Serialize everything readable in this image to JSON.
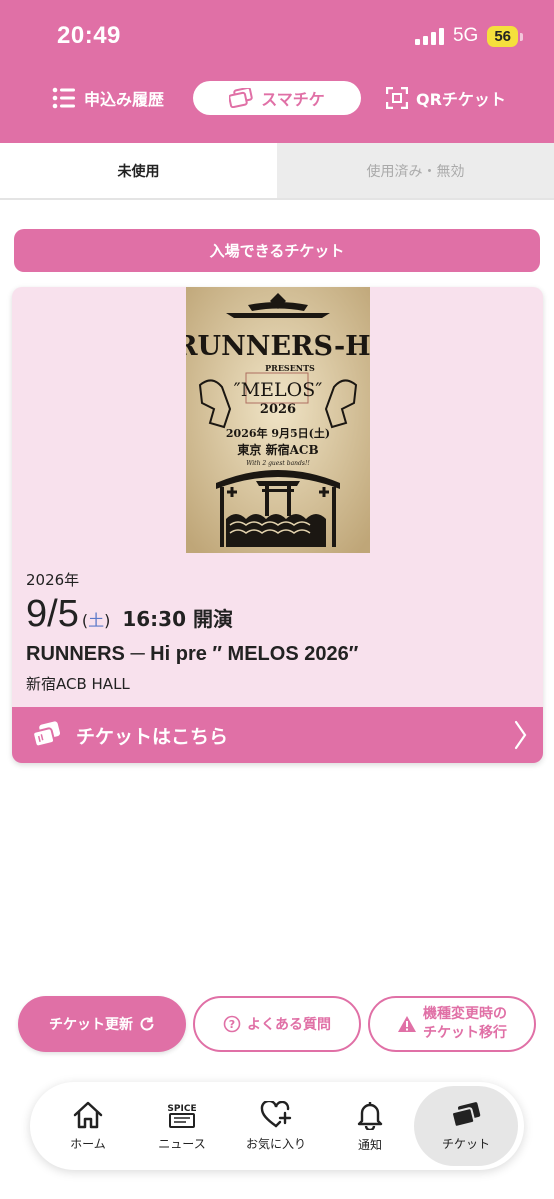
{
  "status_bar": {
    "time": "20:49",
    "network": "5G",
    "battery": "56"
  },
  "top_nav": {
    "history_label": "申込み履歴",
    "smart_ticket_label": "スマチケ",
    "qr_ticket_label": "QRチケット"
  },
  "sub_tabs": {
    "unused": "未使用",
    "used_invalid": "使用済み・無効"
  },
  "section_title": "入場できるチケット",
  "ticket": {
    "year": "2026年",
    "date": "9/5",
    "dow_open": "(",
    "dow": "土",
    "dow_close": ")",
    "time": "16:30 開演",
    "title": "RUNNERS ─ Hi pre ″ MELOS 2026″",
    "venue": "新宿ACB HALL",
    "link_label": "チケットはこちら",
    "poster": {
      "band": "RUNNERS-Hi",
      "presents": "PRESENTS",
      "event": "″MELOS″",
      "year": "2026",
      "date": "2026年 9月5日(土)",
      "venue": "東京 新宿ACB",
      "guests": "With 2 guest bands!!"
    }
  },
  "actions": {
    "refresh_label": "チケット更新",
    "faq_label": "よくある質問",
    "transfer_line1": "機種変更時の",
    "transfer_line2": "チケット移行"
  },
  "tab_bar": {
    "home": "ホーム",
    "news": "ニュース",
    "news_icon_text": "SPICE",
    "favorites": "お気に入り",
    "notifications": "通知",
    "tickets": "チケット"
  },
  "colors": {
    "brand": "#e070a6",
    "card_bg": "#f8e1ed",
    "dow_blue": "#5b79c9"
  }
}
